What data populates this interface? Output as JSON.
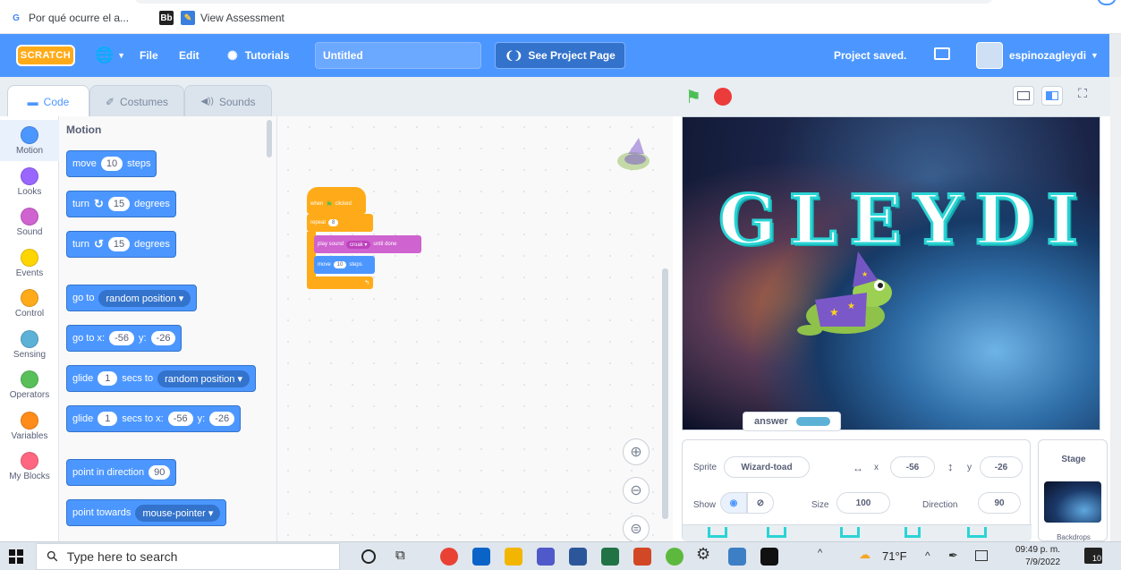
{
  "bookmarks": [
    {
      "label": "Por qué ocurre el a...",
      "icon": "G"
    },
    {
      "label": "",
      "icon": "Bb"
    },
    {
      "label": "View Assessment",
      "icon": "pencil"
    }
  ],
  "menu": {
    "logo": "SCRATCH",
    "file": "File",
    "edit": "Edit",
    "tutorials": "Tutorials",
    "title_value": "Untitled",
    "see_project": "See Project Page",
    "saved": "Project saved.",
    "username": "espinozagleydi"
  },
  "tabs": {
    "code": "Code",
    "costumes": "Costumes",
    "sounds": "Sounds"
  },
  "categories": [
    {
      "label": "Motion",
      "color": "#4c97ff"
    },
    {
      "label": "Looks",
      "color": "#9966ff"
    },
    {
      "label": "Sound",
      "color": "#cf63cf"
    },
    {
      "label": "Events",
      "color": "#ffd500"
    },
    {
      "label": "Control",
      "color": "#ffab19"
    },
    {
      "label": "Sensing",
      "color": "#5cb1d6"
    },
    {
      "label": "Operators",
      "color": "#59c059"
    },
    {
      "label": "Variables",
      "color": "#ff8c1a"
    },
    {
      "label": "My Blocks",
      "color": "#ff6680"
    }
  ],
  "palette": {
    "heading": "Motion",
    "move": {
      "pre": "move",
      "val": "10",
      "post": "steps"
    },
    "turn_right": {
      "pre": "turn",
      "val": "15",
      "post": "degrees"
    },
    "turn_left": {
      "pre": "turn",
      "val": "15",
      "post": "degrees"
    },
    "goto": {
      "pre": "go to",
      "drop": "random position"
    },
    "gotoxy": {
      "pre": "go to x:",
      "x": "-56",
      "mid": "y:",
      "y": "-26"
    },
    "glide_to": {
      "pre": "glide",
      "val": "1",
      "mid": "secs to",
      "drop": "random position"
    },
    "glide_xy": {
      "pre": "glide",
      "val": "1",
      "mid": "secs to x:",
      "x": "-56",
      "mid2": "y:",
      "y": "-26"
    },
    "point_dir": {
      "pre": "point in direction",
      "val": "90"
    },
    "point_towards": {
      "pre": "point towards",
      "drop": "mouse-pointer"
    }
  },
  "script": {
    "hat": "when",
    "hat2": "clicked",
    "repeat": "repeat",
    "repeat_val": "8",
    "play": "play sound",
    "sound": "croak",
    "until": "until done",
    "move": "move",
    "move_val": "10",
    "steps": "steps"
  },
  "stage": {
    "title": "GLEYDI",
    "answer_label": "answer"
  },
  "sprite": {
    "sprite_label": "Sprite",
    "name": "Wizard-toad",
    "x_label": "x",
    "x": "-56",
    "y_label": "y",
    "y": "-26",
    "show_label": "Show",
    "size_label": "Size",
    "size": "100",
    "direction_label": "Direction",
    "direction": "90"
  },
  "stage_pane": {
    "label": "Stage",
    "backdrops": "Backdrops"
  },
  "taskbar": {
    "search_placeholder": "Type here to search",
    "temp": "71°F",
    "time": "09:49 p. m.",
    "date": "7/9/2022",
    "notif": "10"
  }
}
